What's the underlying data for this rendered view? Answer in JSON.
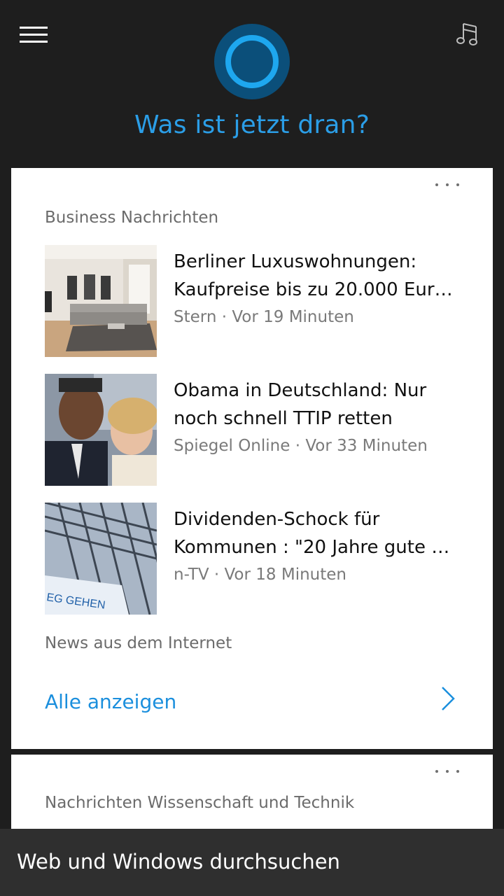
{
  "header": {
    "greeting": "Was ist jetzt dran?",
    "menu_icon": "hamburger-menu-icon",
    "music_icon": "music-note-icon",
    "accent": "#2b9ee7"
  },
  "card1": {
    "title": "Business Nachrichten",
    "items": [
      {
        "headline": "Berliner Luxuswohnungen:\nKaufpreise bis zu 20.000 Eur…",
        "source": "Stern",
        "time": "Vor 19 Minuten",
        "meta": "Stern · Vor 19 Minuten"
      },
      {
        "headline": "Obama in Deutschland: Nur\nnoch schnell TTIP retten",
        "source": "Spiegel Online",
        "time": "Vor 33 Minuten",
        "meta": "Spiegel Online · Vor 33 Minuten"
      },
      {
        "headline": "Dividenden-Schock für\nKommunen : \"20 Jahre gute …",
        "source": "n-TV",
        "time": "Vor 18 Minuten",
        "meta": "n-TV · Vor 18 Minuten"
      }
    ],
    "footer_note": "News aus dem Internet",
    "show_all": "Alle anzeigen"
  },
  "card2": {
    "title": "Nachrichten Wissenschaft und Technik"
  },
  "search": {
    "placeholder": "Web und Windows durchsuchen"
  },
  "colors": {
    "background": "#1e1e1e",
    "link": "#1b8fdd",
    "searchbar": "#2f2f2f"
  }
}
